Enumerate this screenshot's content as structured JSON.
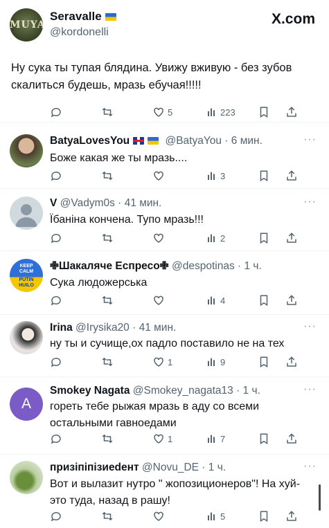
{
  "header": {
    "brand": "X.com"
  },
  "main_post": {
    "author_name": "Seravalle",
    "avatar_text": "MUYA",
    "handle": "@kordonelli",
    "text": "Ну сука ты тупая блядина. Увижу вживую - без зубов скалиться будешь, мразь ебучая!!!!!",
    "views": "223"
  },
  "replies": [
    {
      "name": "BatyaLovesYou",
      "handle": "@BatyaYou",
      "time": "6 мин.",
      "text": "Боже какая же ты мразь....",
      "likes": "",
      "views": "3"
    },
    {
      "name": "V",
      "handle": "@Vadym0s",
      "time": "41 мин.",
      "text": "Їбаніна кончена. Тупо мразь!!!",
      "likes": "",
      "views": "2"
    },
    {
      "name": "✙Шакаляче Еспресо✙",
      "handle": "@despotinas",
      "time": "1 ч.",
      "text": "Сука людожерська",
      "avatar_text": [
        "KEEP",
        "CALM",
        "PUTIN",
        "HUILO"
      ],
      "likes": "",
      "views": "4"
    },
    {
      "name": "Irina",
      "handle": "@Irysika20",
      "time": "41 мин.",
      "text": "ну ты и сучище,ох падло поставило не на тех",
      "likes": "1",
      "views": "9"
    },
    {
      "name": "Smokey Nagata",
      "handle": "@Smokey_nagata13",
      "time": "1 ч.",
      "text": "гореть тебе рыжая мразь в аду со всеми остальными гавноедами",
      "avatar_letter": "A",
      "likes": "1",
      "views": "7"
    },
    {
      "name": "призіпіпізиеdент",
      "handle": "@Novu_DE",
      "time": "1 ч.",
      "text": "Вот и вылазит нутро \" жопозиционеров\"! На хуй-это туда, назад в рашу!",
      "likes": "",
      "views": "5"
    }
  ],
  "more_label": "···",
  "colors": {
    "text": "#0f1419",
    "muted": "#536471",
    "divider": "#eff3f4",
    "smokey_avatar": "#7b5cc7"
  }
}
